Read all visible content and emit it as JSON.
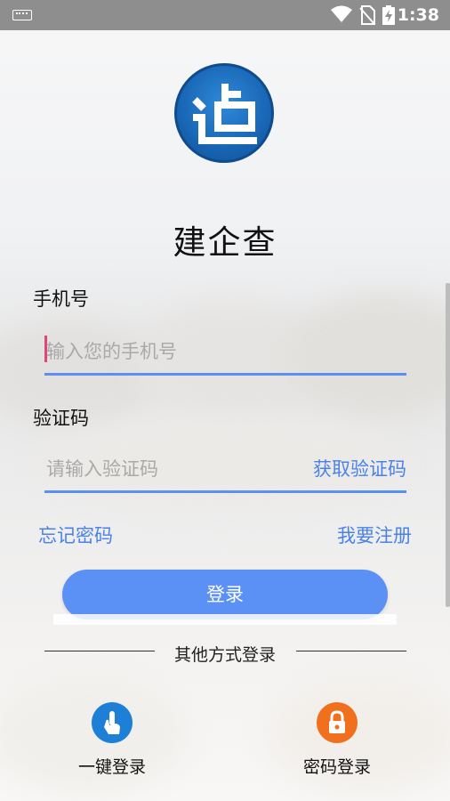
{
  "status_bar": {
    "time": "1:38"
  },
  "app": {
    "name": "建企查"
  },
  "phone": {
    "label": "手机号",
    "placeholder": "输入您的手机号"
  },
  "code": {
    "label": "验证码",
    "placeholder": "请输入验证码",
    "get_code": "获取验证码"
  },
  "links": {
    "forgot": "忘记密码",
    "register": "我要注册"
  },
  "login_button": "登录",
  "other": {
    "divider": "其他方式登录",
    "one_click": {
      "label": "一键登录",
      "icon": "tap-hand-icon",
      "color": "#1e7fd6"
    },
    "password": {
      "label": "密码登录",
      "icon": "lock-icon",
      "color": "#f0701e"
    }
  },
  "colors": {
    "accent": "#5b90f5",
    "link": "#4a82e8",
    "status_bar": "#8e8e8e"
  }
}
